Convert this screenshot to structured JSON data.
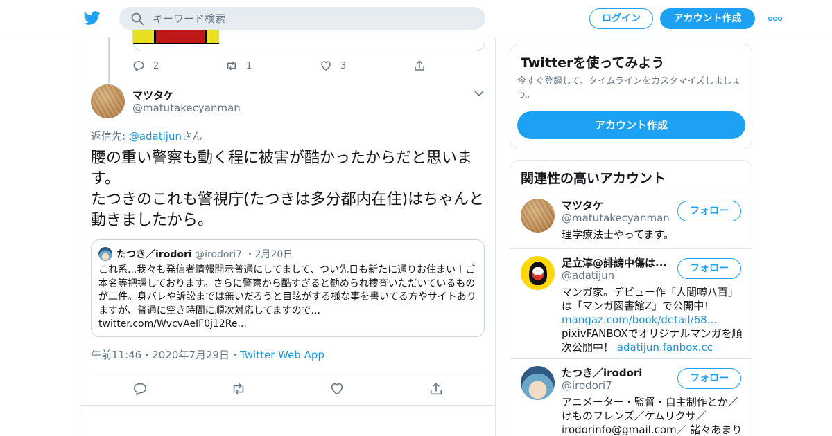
{
  "header": {
    "search_placeholder": "キーワード検索",
    "login_label": "ログイン",
    "signup_label": "アカウント作成"
  },
  "prev_tweet": {
    "reply_count": "2",
    "retweet_count": "1",
    "like_count": "3"
  },
  "tweet": {
    "name": "マツタケ",
    "handle": "@matutakecyanman",
    "reply_prefix": "返信先: ",
    "reply_handle": "@adatijun",
    "reply_suffix": "さん",
    "text_line1": "腰の重い警察も動く程に被害が酷かったからだと思います。",
    "text_line2": "たつきのこれも警視庁(たつきは多分都内在住)はちゃんと動きましたから。",
    "time": "午前11:46",
    "date": "2020年7月29日",
    "source": "Twitter Web App"
  },
  "quote": {
    "name": "たつき／irodori",
    "handle": "@irodori7",
    "date": "2月20日",
    "text": "これ系...我々も発信者情報開示普通にしてまして、つい先日も新たに通りお住まい＋ご本名等把握しております。さらに警察から酷すぎると勧められ捜査いただいているものが二件。身バレや訴訟までは無いだろうと目眩がする様な事を書いてる方やサイトありますが、普通に空き時間に順次対応してますので...",
    "link": "twitter.com/WvcvAeIF0j12Re..."
  },
  "sidebar": {
    "signup_card": {
      "title": "Twitterを使ってみよう",
      "desc": "今すぐ登録して、タイムラインをカスタマイズしましょう。",
      "button": "アカウント作成"
    },
    "related": {
      "title": "関連性の高いアカウント",
      "follow_label": "フォロー",
      "accounts": [
        {
          "name": "マツタケ",
          "handle": "@matutakecyanman",
          "bio": "理学療法士やってます。"
        },
        {
          "name": "足立淳@誹謗中傷は...",
          "handle": "@adatijun",
          "bio_text1": "マンガ家。デビュー作「人間噂八百」は「マンガ図書館Z」で公開中！",
          "bio_link1": "mangaz.com/book/detail/68...",
          "bio_text2": "pixivFANBOXでオリジナルマンガを順次公開中！",
          "bio_link2": "adatijun.fanbox.cc"
        },
        {
          "name": "たつき／irodori",
          "handle": "@irodori7",
          "bio": "アニメーター・監督・自主制作とか／けものフレンズ／ケムリクサ／irodorinfo@gmail.com／ 諸々あまりお"
        }
      ]
    }
  },
  "colors": {
    "accent": "#1da1f2",
    "link": "#1b95e0",
    "muted": "#657786",
    "border": "#e1e8ed"
  }
}
